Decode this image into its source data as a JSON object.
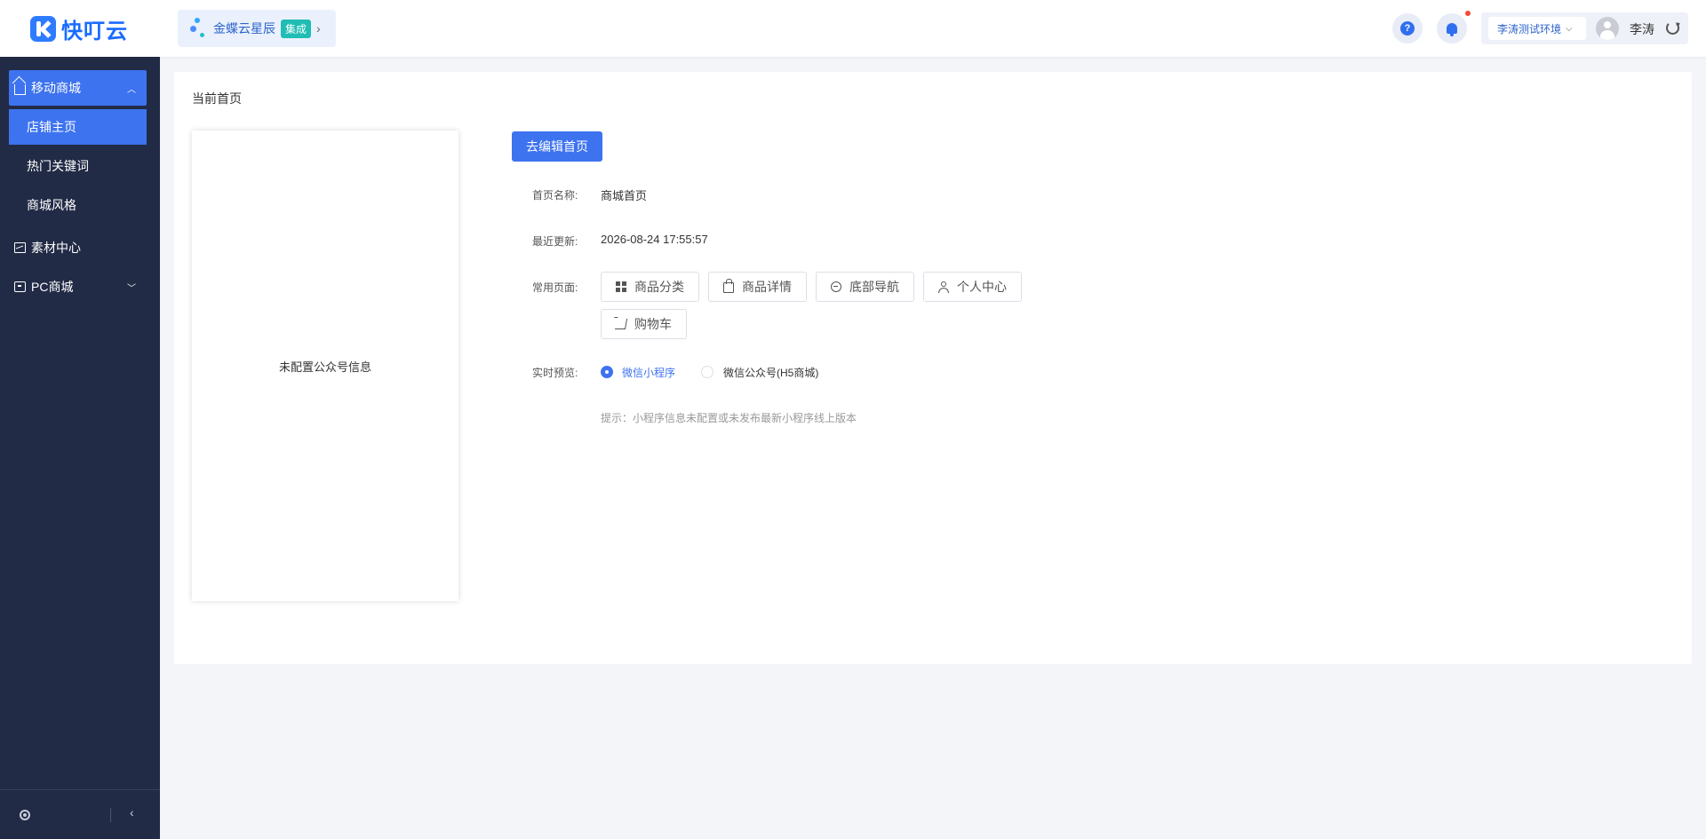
{
  "header": {
    "logo_text": "快叮云",
    "integration": {
      "name": "金蝶云星辰",
      "tag": "集成"
    },
    "environment": "李涛测试环境",
    "user_name": "李涛"
  },
  "sidebar": {
    "groups": [
      {
        "label": "移动商城",
        "expanded": true
      },
      {
        "label": "素材中心"
      },
      {
        "label": "PC商城",
        "expanded": false
      }
    ],
    "sub_items": [
      "店铺主页",
      "热门关键词",
      "商城风格"
    ],
    "active_item": "店铺主页"
  },
  "main": {
    "page_title": "当前首页",
    "preview_text": "未配置公众号信息",
    "edit_button": "去编辑首页",
    "fields": {
      "name_label": "首页名称:",
      "name_value": "商城首页",
      "updated_label": "最近更新:",
      "updated_value": "2026-08-24 17:55:57",
      "common_label": "常用页面:",
      "preview_label": "实时预览:"
    },
    "common_pages": [
      "商品分类",
      "商品详情",
      "底部导航",
      "个人中心",
      "购物车"
    ],
    "preview_options": [
      {
        "label": "微信小程序",
        "checked": true
      },
      {
        "label": "微信公众号(H5商城)",
        "checked": false
      }
    ],
    "hint": "提示：小程序信息未配置或未发布最新小程序线上版本"
  },
  "colors": {
    "primary": "#3d73ef",
    "sidebar_bg": "#222b46",
    "page_bg": "#f4f5f8"
  }
}
